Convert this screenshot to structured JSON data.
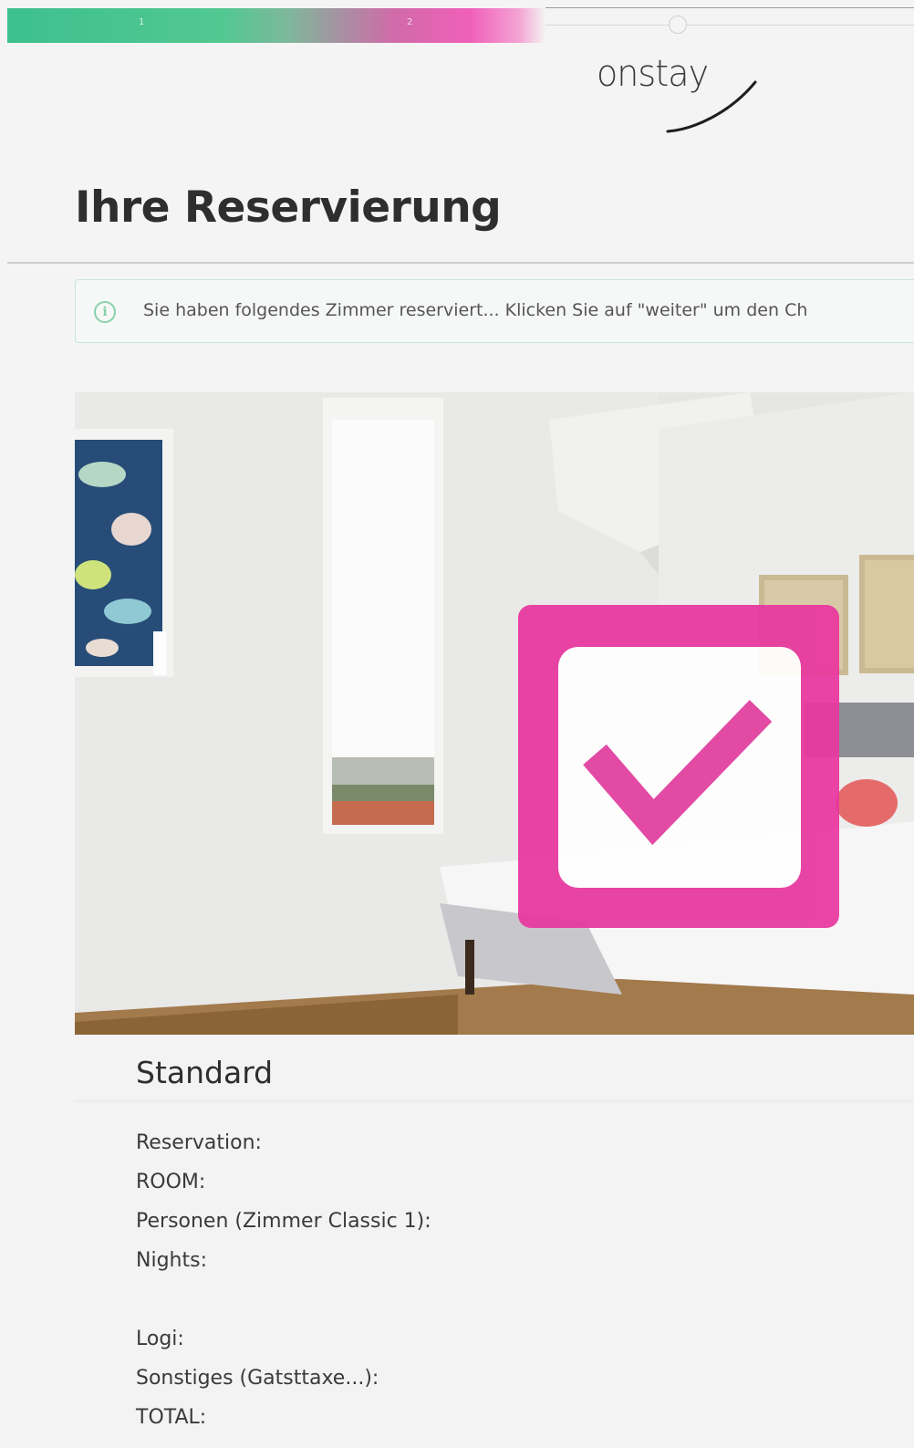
{
  "progress": {
    "steps": [
      "1",
      "2"
    ],
    "colors": {
      "start": "#3dc08e",
      "end": "#f060b9"
    }
  },
  "logo": {
    "text": "onstay"
  },
  "page": {
    "title": "Ihre Reservierung"
  },
  "info_banner": {
    "icon": "info-circle-icon",
    "text": "Sie haben folgendes Zimmer reserviert... Klicken Sie auf \"weiter\" um den Ch"
  },
  "room": {
    "image": "hotel-room-photo",
    "overlay_icon": "checkmark-icon",
    "overlay_color": "#e8379f",
    "name": "Standard",
    "details": [
      "Reservation:",
      "ROOM:",
      "Personen (Zimmer Classic 1):",
      "Nights:",
      "Logi:",
      "Sonstiges (Gatsttaxe...):",
      "TOTAL:"
    ]
  }
}
